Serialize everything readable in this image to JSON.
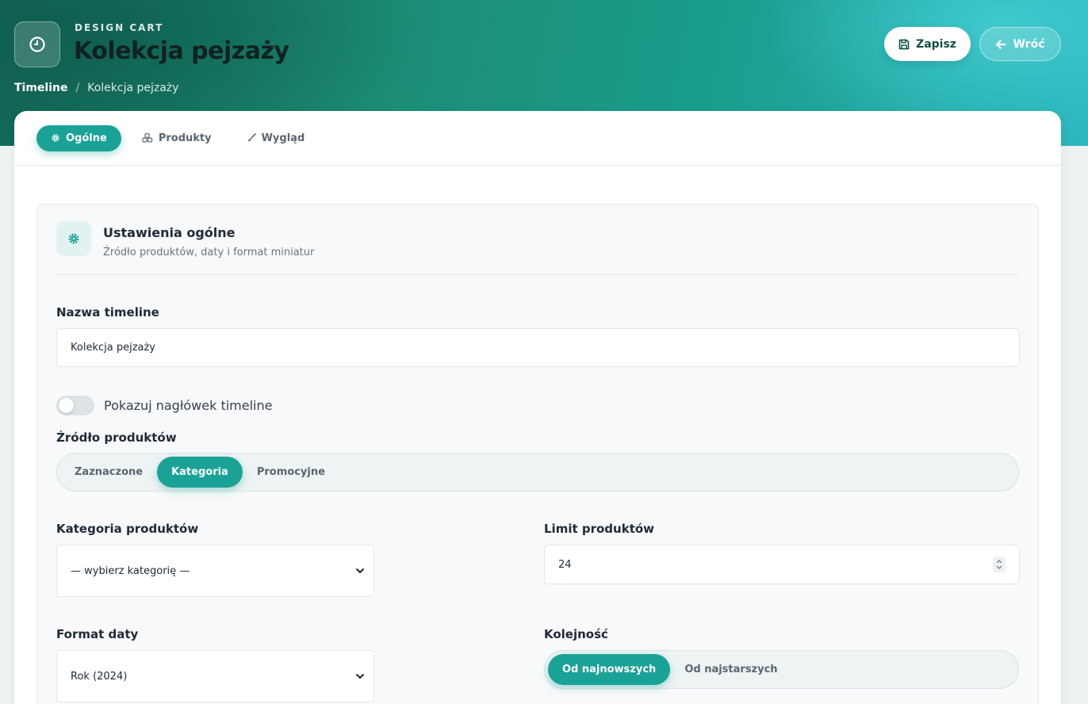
{
  "header": {
    "eyebrow": "DESIGN CART",
    "title": "Kolekcja pejzaży",
    "app_icon": "clock-icon",
    "breadcrumb": {
      "root": "Timeline",
      "separator": "/",
      "current": "Kolekcja pejzaży"
    },
    "actions": {
      "save_label": "Zapisz",
      "save_icon": "floppy-disk-icon",
      "back_label": "Wróć",
      "back_icon": "arrow-left-icon"
    }
  },
  "tabs": [
    {
      "label": "Ogólne",
      "icon": "gear-icon",
      "active": true
    },
    {
      "label": "Produkty",
      "icon": "cubes-icon",
      "active": false
    },
    {
      "label": "Wygląd",
      "icon": "paintbrush-icon",
      "active": false
    }
  ],
  "section": {
    "icon": "gear-icon",
    "title": "Ustawienia ogólne",
    "subtitle": "Źródło produktów, daty i format miniatur"
  },
  "form": {
    "name": {
      "label": "Nazwa timeline",
      "value": "Kolekcja pejzaży"
    },
    "show_header": {
      "label": "Pokazuj nagłówek timeline",
      "checked": false
    },
    "source": {
      "label": "Źródło produktów",
      "options": [
        "Zaznaczone",
        "Kategoria",
        "Promocyjne"
      ],
      "selected": "Kategoria"
    },
    "category": {
      "label": "Kategoria produktów",
      "value": "— wybierz kategorię —"
    },
    "limit": {
      "label": "Limit produktów",
      "value": "24"
    },
    "date_format": {
      "label": "Format daty",
      "value": "Rok (2024)"
    },
    "order": {
      "label": "Kolejność",
      "options": [
        "Od najnowszych",
        "Od najstarszych"
      ],
      "selected": "Od najnowszych"
    }
  },
  "colors": {
    "accent": "#1aa297",
    "hero_start": "#146a58",
    "hero_end": "#2cb6be"
  }
}
